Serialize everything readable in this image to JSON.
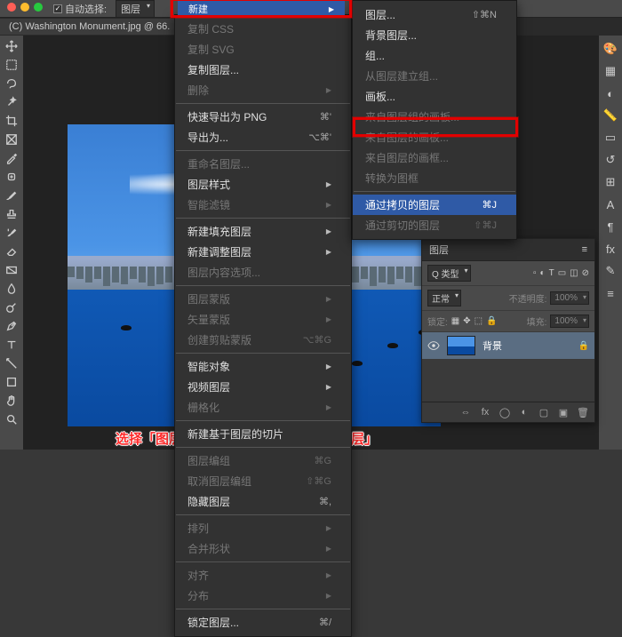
{
  "topbar": {
    "auto_select_label": "自动选择:",
    "layer_select": "图层",
    "xin": "新建"
  },
  "tab": {
    "title": "(C) Washington Monument.jpg @ 66."
  },
  "menu1": {
    "fuzhi_css": "复制 CSS",
    "fuzhi_svg": "复制 SVG",
    "fuzhi_layer": "复制图层...",
    "del": "删除",
    "export_png": "快速导出为 PNG",
    "export_png_key": "⌘'",
    "export_as": "导出为...",
    "export_as_key": "⌥⌘'",
    "rename": "重命名图层...",
    "style": "图层样式",
    "smart_filter": "智能滤镜",
    "new_fill": "新建填充图层",
    "new_adj": "新建调整图层",
    "layer_content": "图层内容选项...",
    "mask": "图层蒙版",
    "vmask": "矢量蒙版",
    "clip": "创建剪贴蒙版",
    "clip_key": "⌥⌘G",
    "smart_obj": "智能对象",
    "video": "视频图层",
    "raster": "栅格化",
    "new_slice": "新建基于图层的切片",
    "group": "图层编组",
    "group_key": "⌘G",
    "ungroup": "取消图层编组",
    "ungroup_key": "⇧⌘G",
    "hide": "隐藏图层",
    "hide_key": "⌘,",
    "arrange": "排列",
    "merge": "合并形状",
    "align": "对齐",
    "distribute": "分布",
    "lock": "锁定图层...",
    "lock_key": "⌘/"
  },
  "menu2": {
    "layer": "图层...",
    "layer_key": "⇧⌘N",
    "bg_layer": "背景图层...",
    "group": "组...",
    "group_from": "从图层建立组...",
    "artboard": "画板...",
    "artboard_from_group": "来自图层组的画板...",
    "artboard_from_layer": "来自图层的画板...",
    "frame_from_layer": "来自图层的画框...",
    "to_frame": "转换为图框",
    "via_copy": "通过拷贝的图层",
    "via_copy_key": "⌘J",
    "via_cut": "通过剪切的图层",
    "via_cut_key": "⇧⌘J"
  },
  "panel": {
    "title": "图层",
    "kind": "Q 类型",
    "blend": "正常",
    "opacity_label": "不透明度:",
    "opacity_val": "100%",
    "lock_label": "锁定:",
    "fill_label": "填充:",
    "fill_val": "100%",
    "layer_name": "背景"
  },
  "caption": "选择「图层」-「新建」-「通过拷贝的图层」"
}
